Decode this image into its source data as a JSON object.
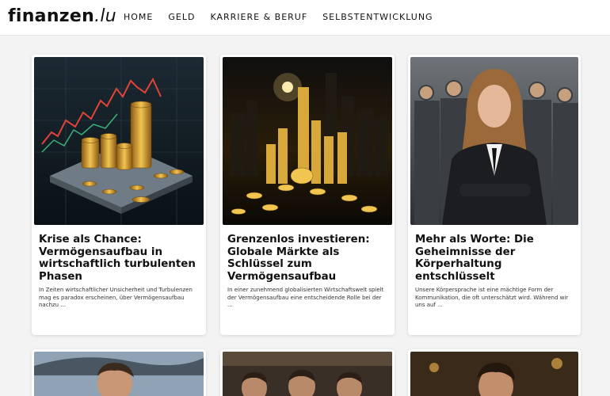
{
  "header": {
    "logo_main": "finanzen",
    "logo_tld": ".lu",
    "nav": [
      "HOME",
      "GELD",
      "KARRIERE & BERUF",
      "SELBSTENTWICKLUNG"
    ]
  },
  "articles": [
    {
      "title": "Krise als Chance: Vermögensaufbau in wirtschaftlich turbulenten Phasen",
      "excerpt": "In Zeiten wirtschaftlicher Unsicherheit und Turbulenzen mag es paradox erscheinen, über Vermögensaufbau nachzu ..."
    },
    {
      "title": "Grenzenlos investieren: Globale Märkte als Schlüssel zum Vermögensaufbau",
      "excerpt": "In einer zunehmend globalisierten Wirtschaftswelt spielt der Vermögensaufbau eine entscheidende Rolle bei der ..."
    },
    {
      "title": "Mehr als Worte: Die Geheimnisse der Körperhaltung entschlüsselt",
      "excerpt": "Unsere Körpersprache ist eine mächtige Form der Kommunikation, die oft unterschätzt wird. Während wir uns auf ..."
    }
  ],
  "colors": {
    "page_bg": "#f3f3f3",
    "header_bg": "#ffffff",
    "text": "#111111",
    "gold": "#d4a437"
  },
  "icons": [
    "gold-coins-chart-image",
    "city-gold-coins-image",
    "business-woman-image",
    "man-portrait-image",
    "group-people-image",
    "man-portrait-image"
  ]
}
